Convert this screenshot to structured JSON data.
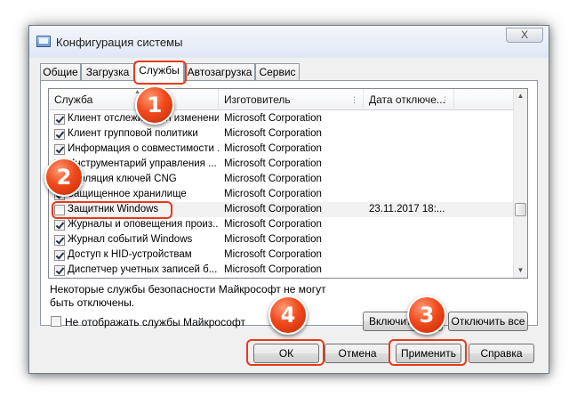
{
  "window": {
    "title": "Конфигурация системы",
    "close_glyph": "X"
  },
  "tabs": [
    "Общие",
    "Загрузка",
    "Службы",
    "Автозагрузка",
    "Сервис"
  ],
  "active_tab": "Службы",
  "columns": {
    "service": "Служба",
    "vendor": "Изготовитель",
    "date": "Дата отключе..."
  },
  "services": [
    {
      "name": "Клиент отслеживания изменени...",
      "vendor": "Microsoft Corporation",
      "date": "",
      "checked": true
    },
    {
      "name": "Клиент групповой политики",
      "vendor": "Microsoft Corporation",
      "date": "",
      "checked": true
    },
    {
      "name": "Информация о совместимости ...",
      "vendor": "Microsoft Corporation",
      "date": "",
      "checked": true
    },
    {
      "name": "Инструментарий управления ...",
      "vendor": "Microsoft Corporation",
      "date": "",
      "checked": true
    },
    {
      "name": "Изоляция ключей CNG",
      "vendor": "Microsoft Corporation",
      "date": "",
      "checked": true
    },
    {
      "name": "Защищенное хранилище",
      "vendor": "Microsoft Corporation",
      "date": "",
      "checked": true
    },
    {
      "name": "Защитник Windows",
      "vendor": "Microsoft Corporation",
      "date": "23.11.2017 18:...",
      "checked": false
    },
    {
      "name": "Журналы и оповещения произ...",
      "vendor": "Microsoft Corporation",
      "date": "",
      "checked": true
    },
    {
      "name": "Журнал событий Windows",
      "vendor": "Microsoft Corporation",
      "date": "",
      "checked": true
    },
    {
      "name": "Доступ к HID-устройствам",
      "vendor": "Microsoft Corporation",
      "date": "",
      "checked": true
    },
    {
      "name": "Диспетчер учетных записей б...",
      "vendor": "Microsoft Corporation",
      "date": "",
      "checked": true
    }
  ],
  "note": "Некоторые службы безопасности Майкрософт не могут быть отключены.",
  "buttons": {
    "enable_all": "Включить все",
    "disable_all": "Отключить все",
    "ok": "ОК",
    "cancel": "Отмена",
    "apply": "Применить",
    "help": "Справка"
  },
  "hide_ms_services": {
    "label": "Не отображать службы Майкрософт",
    "checked": false
  },
  "callouts": [
    "1",
    "2",
    "3",
    "4"
  ],
  "colors": {
    "callout": "#f04a1c",
    "highlight_border": "#e83a1a"
  }
}
